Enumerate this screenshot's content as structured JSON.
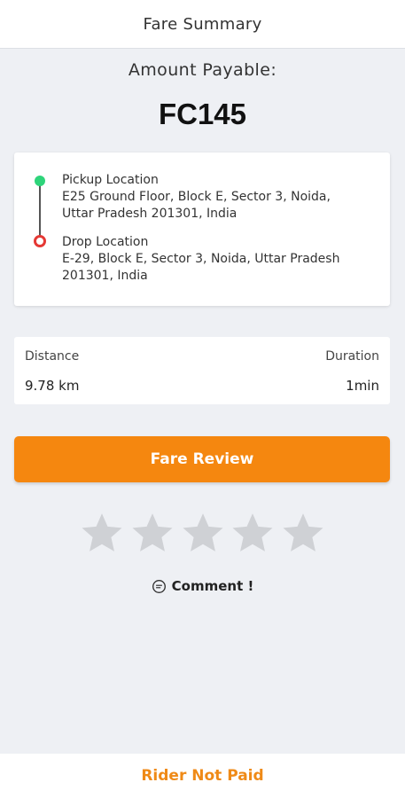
{
  "header": {
    "title": "Fare Summary"
  },
  "amount": {
    "label": "Amount Payable:",
    "value": "FC145"
  },
  "route": {
    "pickup": {
      "label": "Pickup Location",
      "address_line1": "E25 Ground Floor, Block E, Sector 3, Noida,",
      "address_line2": "Uttar Pradesh 201301, India"
    },
    "drop": {
      "label": "Drop Location",
      "address_line1": "E-29, Block E, Sector 3, Noida, Uttar Pradesh",
      "address_line2": "201301, India"
    }
  },
  "trip": {
    "distance_label": "Distance",
    "distance_value": "9.78 km",
    "duration_label": "Duration",
    "duration_value": "1min"
  },
  "fare_review": {
    "label": "Fare Review"
  },
  "rating": {
    "value": 0,
    "max": 5
  },
  "comment": {
    "label": "Comment !",
    "icon": "comment-icon"
  },
  "footer": {
    "label": "Rider Not Paid"
  },
  "colors": {
    "accent": "#f5870f",
    "pickup_dot": "#2ed47a",
    "drop_pin": "#e53935",
    "star_empty": "#cfd1d5",
    "footer_text": "#ef8a17"
  }
}
